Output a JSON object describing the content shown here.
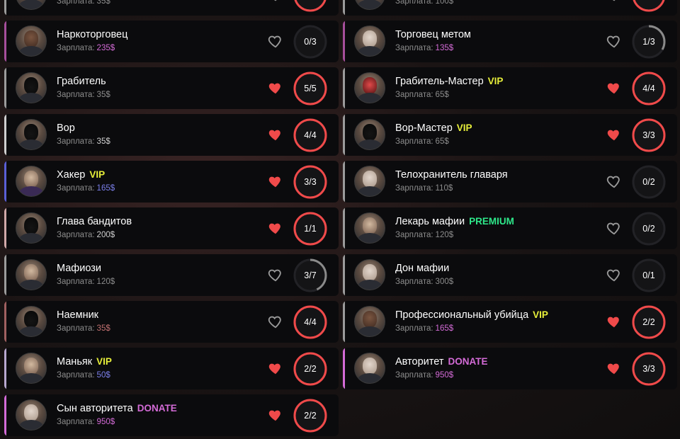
{
  "currency": "$",
  "salary_label": "Зарплата:",
  "colors": {
    "heart_active": "#f04a4a",
    "heart_inactive": "#9a9a9a",
    "ring_full": "#f04a4a",
    "ring_partial": "#8a8a8a",
    "ring_track": "#222226",
    "vip": "#e7ef3a",
    "premium": "#2ee88a",
    "donate": "#d46bd7",
    "salary_default": "#8c8c8c",
    "salary_donate": "#d46bd7",
    "salary_vip": "#7a7ee8"
  },
  "jobs": [
    {
      "name": "",
      "tag": "",
      "tag_type": "",
      "salary_amount": "35",
      "favorite": false,
      "slots": "",
      "fill": 1,
      "accent": "#9b9b9b",
      "salary_color": "#8c8c8c",
      "avatar": "",
      "partial_top": true
    },
    {
      "name": "",
      "tag": "",
      "tag_type": "",
      "salary_amount": "100",
      "favorite": false,
      "slots": "",
      "fill": 1,
      "accent": "#9b9b9b",
      "salary_color": "#8c8c8c",
      "avatar": "",
      "partial_top": true
    },
    {
      "name": "Наркоторговец",
      "tag": "",
      "tag_type": "",
      "salary_amount": "235",
      "favorite": false,
      "slots": "0/3",
      "fill": 0,
      "accent": "#a64f9b",
      "salary_color": "#d46bd7",
      "avatar": "dark"
    },
    {
      "name": "Торговец метом",
      "tag": "",
      "tag_type": "",
      "salary_amount": "135",
      "favorite": false,
      "slots": "1/3",
      "fill": 0.333,
      "accent": "#a64f9b",
      "salary_color": "#d46bd7",
      "avatar": "bald"
    },
    {
      "name": "Грабитель",
      "tag": "",
      "tag_type": "",
      "salary_amount": "35",
      "favorite": true,
      "slots": "5/5",
      "fill": 1,
      "accent": "#9b9b9b",
      "salary_color": "#8c8c8c",
      "avatar": "mask"
    },
    {
      "name": "Грабитель-Мастер",
      "tag": "VIP",
      "tag_type": "vip",
      "salary_amount": "65",
      "favorite": true,
      "slots": "4/4",
      "fill": 1,
      "accent": "#9b9b9b",
      "salary_color": "#8c8c8c",
      "avatar": "clown"
    },
    {
      "name": "Вор",
      "tag": "",
      "tag_type": "",
      "salary_amount": "35",
      "favorite": true,
      "slots": "4/4",
      "fill": 1,
      "accent": "#cfcfcf",
      "salary_color": "#cfcfcf",
      "avatar": "mask"
    },
    {
      "name": "Вор-Мастер",
      "tag": "VIP",
      "tag_type": "vip",
      "salary_amount": "65",
      "favorite": true,
      "slots": "3/3",
      "fill": 1,
      "accent": "#9b9b9b",
      "salary_color": "#8c8c8c",
      "avatar": "mask"
    },
    {
      "name": "Хакер",
      "tag": "VIP",
      "tag_type": "vip",
      "salary_amount": "165",
      "favorite": true,
      "slots": "3/3",
      "fill": 1,
      "accent": "#5a5fd6",
      "salary_color": "#7a7ee8",
      "avatar": "purple"
    },
    {
      "name": "Телохранитель главаря",
      "tag": "",
      "tag_type": "",
      "salary_amount": "110",
      "favorite": false,
      "slots": "0/2",
      "fill": 0,
      "accent": "#9b9b9b",
      "salary_color": "#8c8c8c",
      "avatar": "bald"
    },
    {
      "name": "Глава бандитов",
      "tag": "",
      "tag_type": "",
      "salary_amount": "200",
      "favorite": true,
      "slots": "1/1",
      "fill": 1,
      "accent": "#d0a8a8",
      "salary_color": "#cfcfcf",
      "avatar": "mask"
    },
    {
      "name": "Лекарь мафии",
      "tag": "PREMIUM",
      "tag_type": "premium",
      "salary_amount": "120",
      "favorite": false,
      "slots": "0/2",
      "fill": 0,
      "accent": "#9b9b9b",
      "salary_color": "#8c8c8c",
      "avatar": ""
    },
    {
      "name": "Мафиози",
      "tag": "",
      "tag_type": "",
      "salary_amount": "120",
      "favorite": false,
      "slots": "3/7",
      "fill": 0.4286,
      "accent": "#9b9b9b",
      "salary_color": "#8c8c8c",
      "avatar": ""
    },
    {
      "name": "Дон мафии",
      "tag": "",
      "tag_type": "",
      "salary_amount": "300",
      "favorite": false,
      "slots": "0/1",
      "fill": 0,
      "accent": "#9b9b9b",
      "salary_color": "#8c8c8c",
      "avatar": "bald"
    },
    {
      "name": "Наемник",
      "tag": "",
      "tag_type": "",
      "salary_amount": "35",
      "favorite": false,
      "slots": "4/4",
      "fill": 1,
      "accent": "#a06060",
      "salary_color": "#c07070",
      "avatar": "mask"
    },
    {
      "name": "Профессиональный убийца",
      "tag": "VIP",
      "tag_type": "vip",
      "salary_amount": "165",
      "favorite": true,
      "slots": "2/2",
      "fill": 1,
      "accent": "#9b9b9b",
      "salary_color": "#d46bd7",
      "avatar": "dark"
    },
    {
      "name": "Маньяк",
      "tag": "VIP",
      "tag_type": "vip",
      "salary_amount": "50",
      "favorite": true,
      "slots": "2/2",
      "fill": 1,
      "accent": "#b8a8cf",
      "salary_color": "#7a7ee8",
      "avatar": ""
    },
    {
      "name": "Авторитет",
      "tag": "DONATE",
      "tag_type": "donate",
      "salary_amount": "950",
      "favorite": true,
      "slots": "3/3",
      "fill": 1,
      "accent": "#d46bd7",
      "salary_color": "#d46bd7",
      "avatar": "bald"
    },
    {
      "name": "Сын авторитета",
      "tag": "DONATE",
      "tag_type": "donate",
      "salary_amount": "950",
      "favorite": true,
      "slots": "2/2",
      "fill": 1,
      "accent": "#d46bd7",
      "salary_color": "#d46bd7",
      "avatar": "bald"
    }
  ]
}
